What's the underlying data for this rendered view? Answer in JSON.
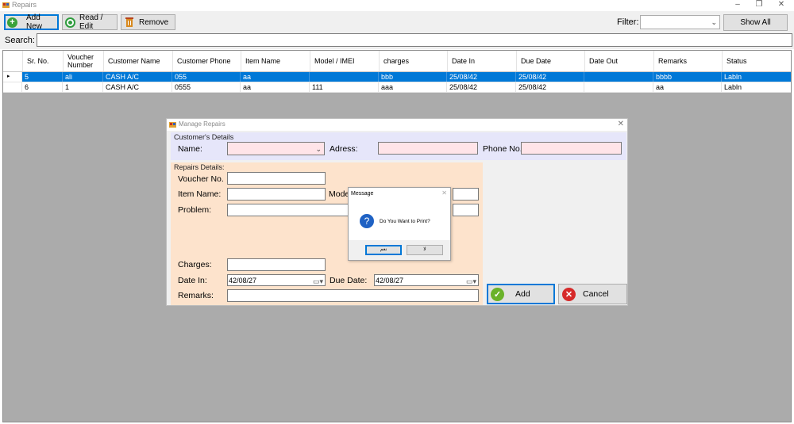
{
  "window": {
    "title": "Repairs",
    "minimize": "–",
    "restore": "❐",
    "close": "✕"
  },
  "toolbar": {
    "add_new": "Add New",
    "read_edit": "Read / Edit",
    "remove": "Remove",
    "filter_label": "Filter:",
    "filter_value": "",
    "show_all": "Show All"
  },
  "search": {
    "label": "Search:",
    "value": ""
  },
  "grid": {
    "columns": [
      "Sr. No.",
      "Voucher Number",
      "Customer Name",
      "Customer Phone",
      "Item Name",
      "Model / IMEI",
      "charges",
      "Date In",
      "Due Date",
      "Date Out",
      "Remarks",
      "Status"
    ],
    "rows": [
      [
        "5",
        "ali",
        "CASH A/C",
        "055",
        "aa",
        "",
        "bbb",
        "25/08/42",
        "25/08/42",
        "",
        "bbbb",
        "Labln"
      ],
      [
        "6",
        "1",
        "CASH A/C",
        "0555",
        "aa",
        "111",
        "aaa",
        "25/08/42",
        "25/08/42",
        "",
        "aa",
        "Labln"
      ]
    ],
    "row_marker": "▸"
  },
  "dialog": {
    "title": "Manage Repairs",
    "close": "✕",
    "customer_group": "Customer's Details",
    "name_label": "Name:",
    "address_label": "Adress:",
    "phone_label": "Phone No.",
    "repairs_group": "Repairs Details:",
    "voucher_label": "Voucher No.",
    "item_label": "Item Name:",
    "model_label": "Mode",
    "problem_label": "Problem:",
    "charges_label": "Charges:",
    "date_in_label": "Date In:",
    "date_in_value": "42/08/27",
    "due_date_label": "Due Date:",
    "due_date_value": "42/08/27",
    "remarks_label": "Remarks:",
    "add_button": "Add",
    "cancel_button": "Cancel"
  },
  "message": {
    "title": "Message",
    "close": "✕",
    "icon": "?",
    "text": "Do You Want to Print?",
    "yes": "نعم",
    "no": "لا"
  }
}
